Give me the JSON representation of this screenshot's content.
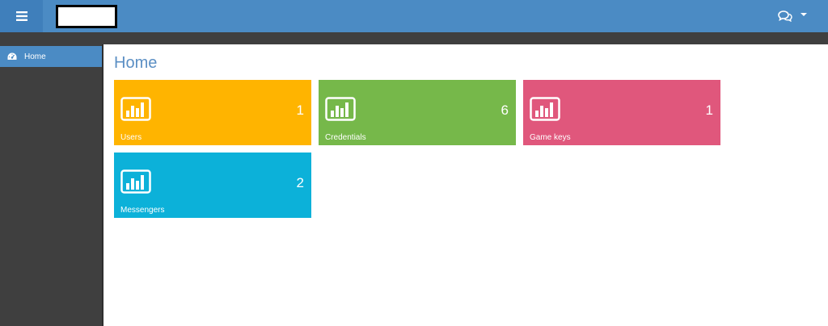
{
  "header": {
    "menu_icon": "hamburger-menu-icon",
    "logo_redacted": true,
    "chat_icon": "chat-bubbles-icon",
    "dropdown_icon": "caret-down-icon",
    "colors": {
      "topbar": "#4b8bc4",
      "menu_button": "#3f7fbb"
    }
  },
  "sidebar": {
    "items": [
      {
        "label": "Home",
        "icon": "dashboard-gauge-icon",
        "active": true
      }
    ],
    "colors": {
      "background": "#3f3f3f",
      "active": "#4b8bc4"
    }
  },
  "main": {
    "title": "Home",
    "tiles": [
      {
        "label": "Users",
        "value": "1",
        "icon": "bar-chart-icon",
        "color": "#ffb400"
      },
      {
        "label": "Credentials",
        "value": "6",
        "icon": "bar-chart-icon",
        "color": "#76b84a"
      },
      {
        "label": "Game keys",
        "value": "1",
        "icon": "bar-chart-icon",
        "color": "#e0577c"
      },
      {
        "label": "Messengers",
        "value": "2",
        "icon": "bar-chart-icon",
        "color": "#0cb1d9"
      }
    ]
  }
}
